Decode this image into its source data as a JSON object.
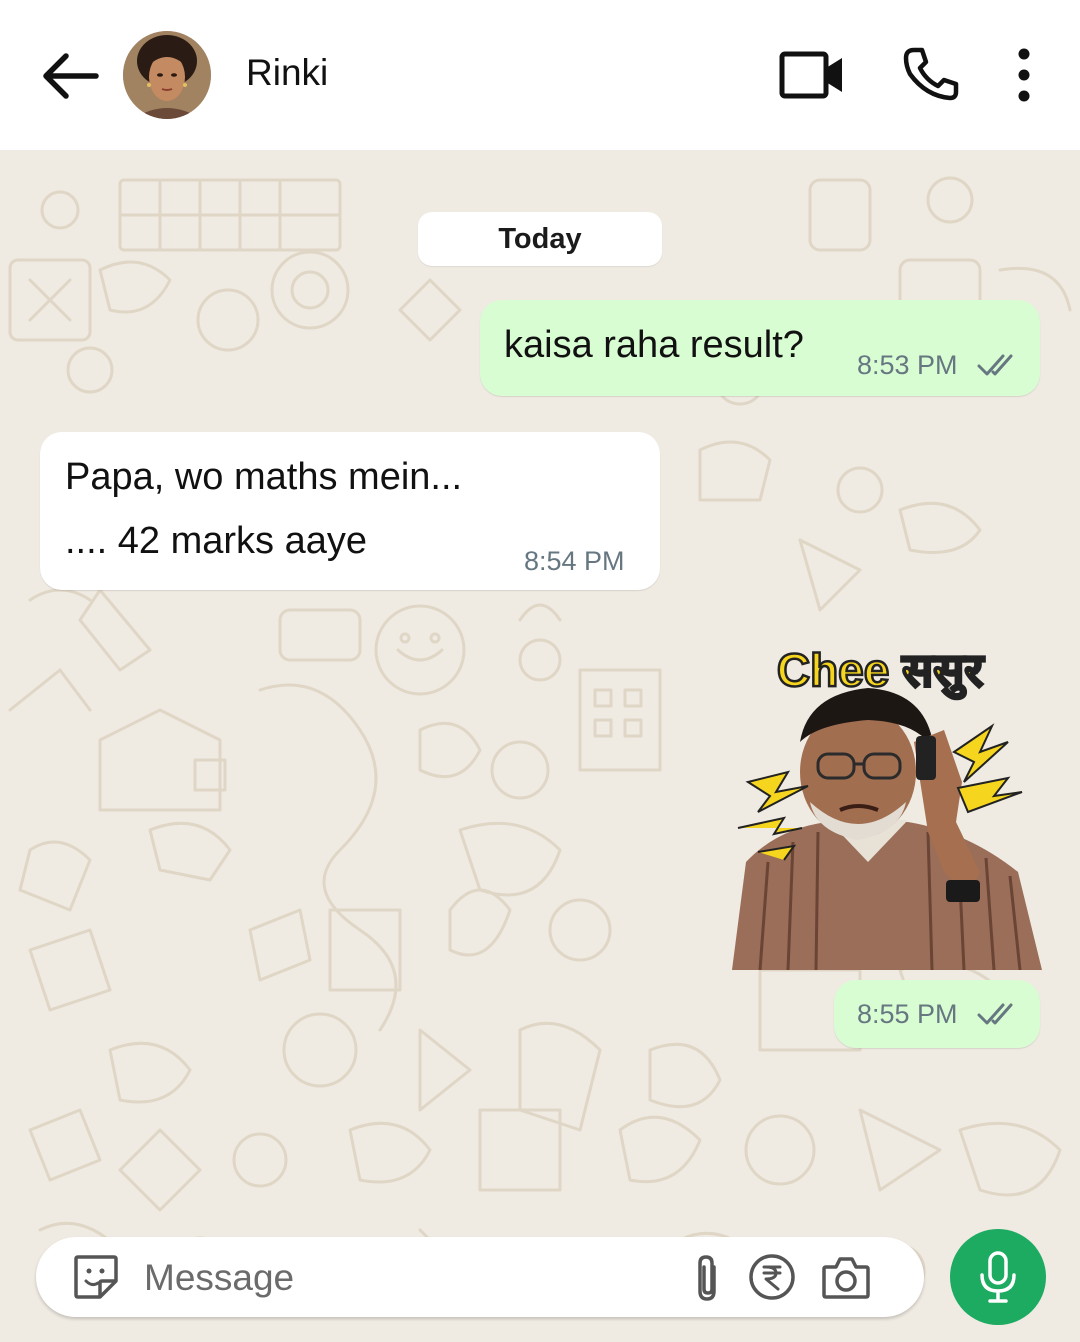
{
  "header": {
    "contact_name": "Rinki"
  },
  "chat": {
    "date_chip": "Today",
    "messages": [
      {
        "direction": "outgoing",
        "text": "kaisa raha result?",
        "time": "8:53 PM",
        "status": "read"
      },
      {
        "direction": "incoming",
        "line1": "Papa, wo maths mein...",
        "line2": ".... 42 marks aaye",
        "time": "8:54 PM"
      },
      {
        "direction": "outgoing",
        "type": "sticker",
        "sticker_text": "Chee ससुर",
        "time": "8:55 PM",
        "status": "read"
      }
    ]
  },
  "composer": {
    "placeholder": "Message"
  },
  "colors": {
    "outgoing_bubble": "#d9fdd3",
    "incoming_bubble": "#ffffff",
    "chat_background": "#efeae2",
    "mic_button": "#1daa61",
    "read_ticks": "#667781"
  },
  "icons": [
    "back-arrow-icon",
    "video-call-icon",
    "phone-icon",
    "more-vertical-icon",
    "sticker-icon",
    "attach-icon",
    "rupee-icon",
    "camera-icon",
    "mic-icon",
    "double-tick-icon"
  ]
}
